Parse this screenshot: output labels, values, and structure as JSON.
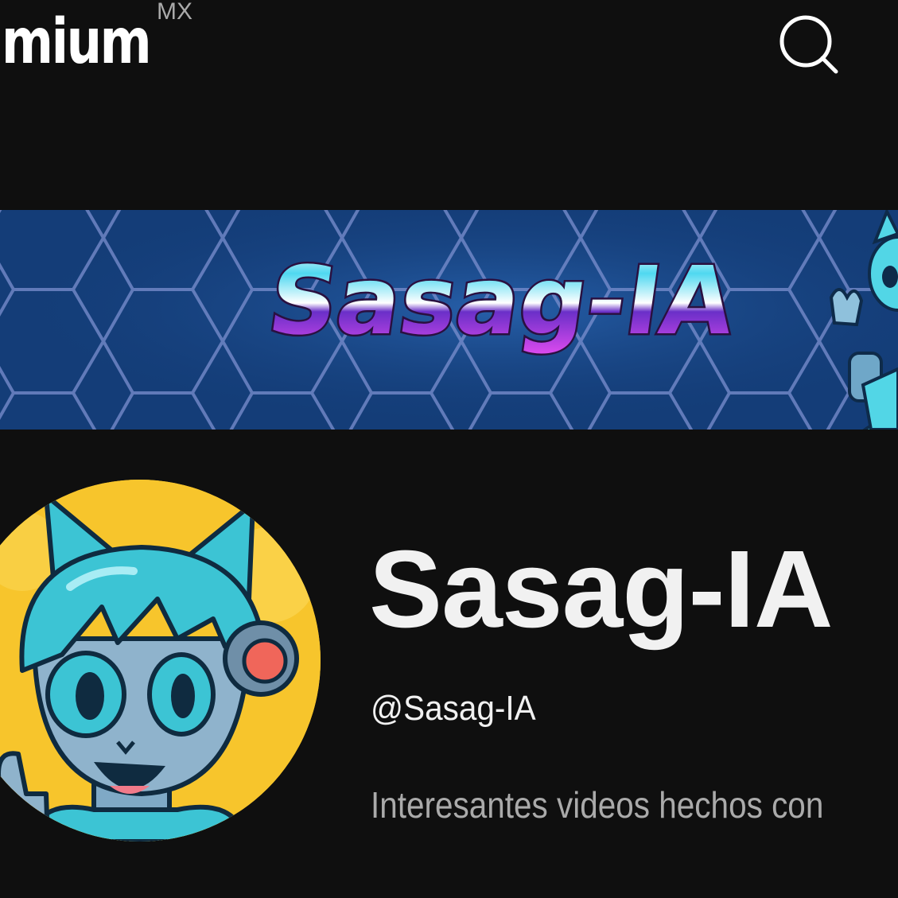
{
  "header": {
    "logo_text": "mium",
    "region_code": "MX",
    "search_icon": "search-icon"
  },
  "banner": {
    "title": "Sasag-IA",
    "colors": {
      "background": "#143d78",
      "hex_lines": "#7a8fcf",
      "title_top": "#4fd8f0",
      "title_bottom": "#b13cf0"
    }
  },
  "channel": {
    "avatar_icon": "robot-cat-avatar",
    "name": "Sasag-IA",
    "handle": "@Sasag-IA",
    "description": "Interesantes videos hechos con"
  },
  "colors": {
    "page_background": "#0f0f0f",
    "primary_text": "#f1f1f1",
    "secondary_text": "#aaaaaa",
    "avatar_background": "#f7c52c"
  }
}
